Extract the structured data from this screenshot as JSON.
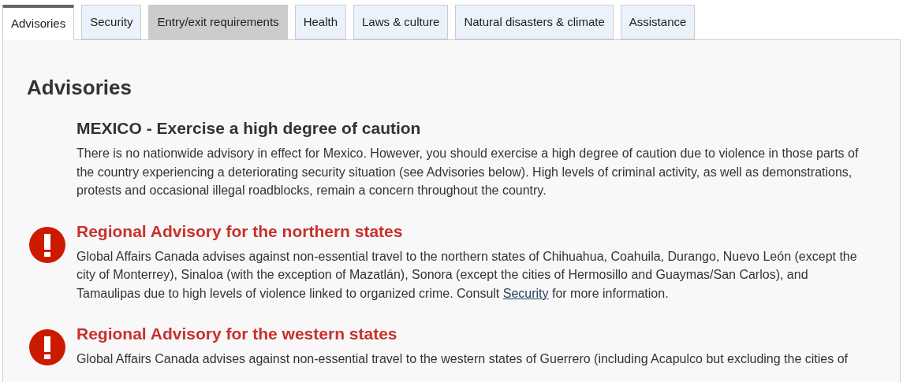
{
  "tabs": [
    {
      "label": "Advisories",
      "selected": true,
      "hovered": false
    },
    {
      "label": "Security",
      "selected": false,
      "hovered": false
    },
    {
      "label": "Entry/exit requirements",
      "selected": false,
      "hovered": true
    },
    {
      "label": "Health",
      "selected": false,
      "hovered": false
    },
    {
      "label": "Laws & culture",
      "selected": false,
      "hovered": false
    },
    {
      "label": "Natural disasters & climate",
      "selected": false,
      "hovered": false
    },
    {
      "label": "Assistance",
      "selected": false,
      "hovered": false
    }
  ],
  "panel": {
    "heading": "Advisories",
    "sections": [
      {
        "kind": "national",
        "title": "MEXICO - Exercise a high degree of caution",
        "text": "There is no nationwide advisory in effect for Mexico. However, you should exercise a high degree of caution due to violence in those parts of the country experiencing a deteriorating security situation (see Advisories below). High levels of criminal activity, as well as demonstrations, protests and occasional illegal roadblocks, remain a concern throughout the country."
      },
      {
        "kind": "regional",
        "title": "Regional Advisory for the northern states",
        "text": "Global Affairs Canada advises against non-essential travel to the northern states of Chihuahua, Coahuila, Durango, Nuevo León (except the city of Monterrey), Sinaloa (with the exception of Mazatlán), Sonora (except the cities of Hermosillo and Guaymas/San Carlos), and Tamaulipas due to high levels of violence linked to organized crime. Consult ",
        "link": "Security",
        "text_after": " for more information."
      },
      {
        "kind": "regional",
        "title": "Regional Advisory for the western states",
        "text": "Global Affairs Canada advises against non-essential travel to the western states of Guerrero (including Acapulco but excluding the cities of"
      }
    ]
  }
}
